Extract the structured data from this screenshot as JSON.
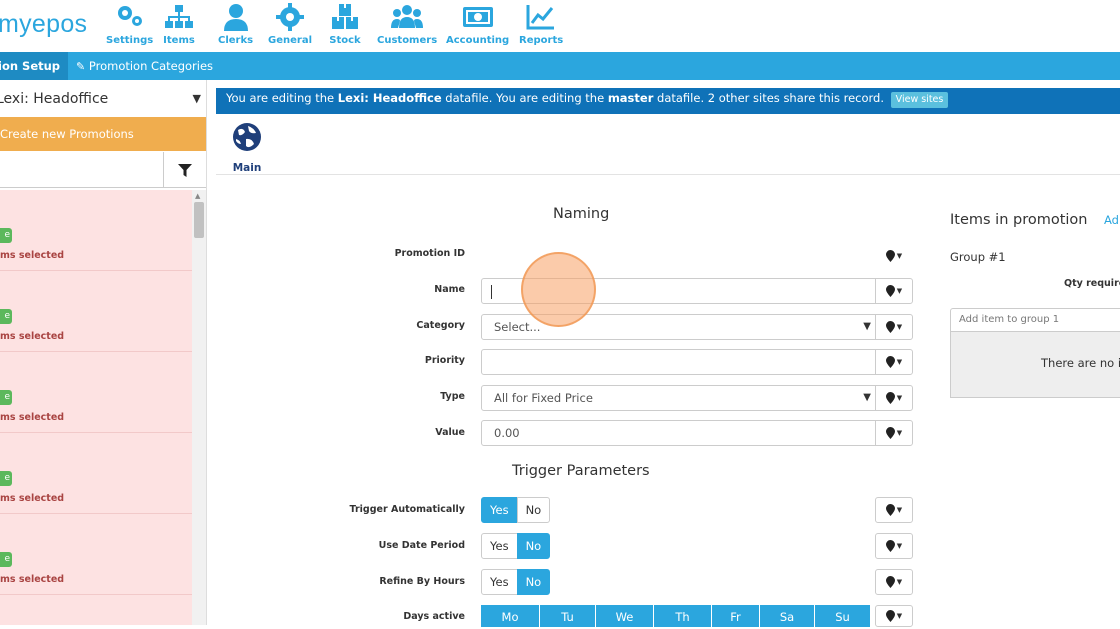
{
  "app": {
    "logo_text": "myepos"
  },
  "nav": {
    "items": [
      {
        "label": "Settings",
        "icon": "settings-icon"
      },
      {
        "label": "Items",
        "icon": "sitemap-icon"
      },
      {
        "label": "Clerks",
        "icon": "user-icon"
      },
      {
        "label": "General",
        "icon": "gear-icon"
      },
      {
        "label": "Stock",
        "icon": "boxes-icon"
      },
      {
        "label": "Customers",
        "icon": "users-icon"
      },
      {
        "label": "Accounting",
        "icon": "money-icon"
      },
      {
        "label": "Reports",
        "icon": "chart-icon"
      }
    ]
  },
  "subnav": {
    "tabs": [
      {
        "label": "ion Setup",
        "active": true
      },
      {
        "label": "Promotion Categories",
        "active": false
      }
    ]
  },
  "left": {
    "site_select": "Lexi: Headoffice",
    "create_button": "Create new Promotions",
    "promos": [
      {
        "badge": "e",
        "meta": "ms selected"
      },
      {
        "badge": "e",
        "meta": "ms selected"
      },
      {
        "badge": "e",
        "meta": "ms selected"
      },
      {
        "badge": "e",
        "meta": "ms selected"
      },
      {
        "badge": "e",
        "meta": "ms selected"
      }
    ]
  },
  "infobar": {
    "text1": "You are editing the ",
    "site": "Lexi: Headoffice",
    "text2": " datafile. You are editing the ",
    "datafile": "master",
    "text3": " datafile. 2 other sites share this record.",
    "view_sites": "View sites"
  },
  "main_tab": {
    "label": "Main"
  },
  "naming": {
    "title": "Naming",
    "promotion_id_label": "Promotion ID",
    "name_label": "Name",
    "name_value": "",
    "category_label": "Category",
    "category_value": "Select...",
    "priority_label": "Priority",
    "priority_value": "",
    "type_label": "Type",
    "type_value": "All for Fixed Price",
    "value_label": "Value",
    "value_value": "0.00"
  },
  "trigger": {
    "title": "Trigger Parameters",
    "trigger_auto_label": "Trigger Automatically",
    "trigger_auto_state": "Yes",
    "use_date_label": "Use Date Period",
    "use_date_state": "No",
    "refine_hours_label": "Refine By Hours",
    "refine_hours_state": "No",
    "days_label": "Days active",
    "yes": "Yes",
    "no": "No",
    "days": [
      "Mo",
      "Tu",
      "We",
      "Th",
      "Fr",
      "Sa",
      "Su"
    ]
  },
  "items_panel": {
    "title": "Items in promotion",
    "add_link": "Ad",
    "group": "Group #1",
    "qty_label": "Qty require",
    "add_item_placeholder": "Add item to group 1",
    "empty_text": "There are no it"
  },
  "colors": {
    "primary": "#2ba6de",
    "infobar": "#0f72b8",
    "create": "#f0ad4e",
    "promo_bg": "#fde2e2",
    "badge": "#5cb85c"
  }
}
